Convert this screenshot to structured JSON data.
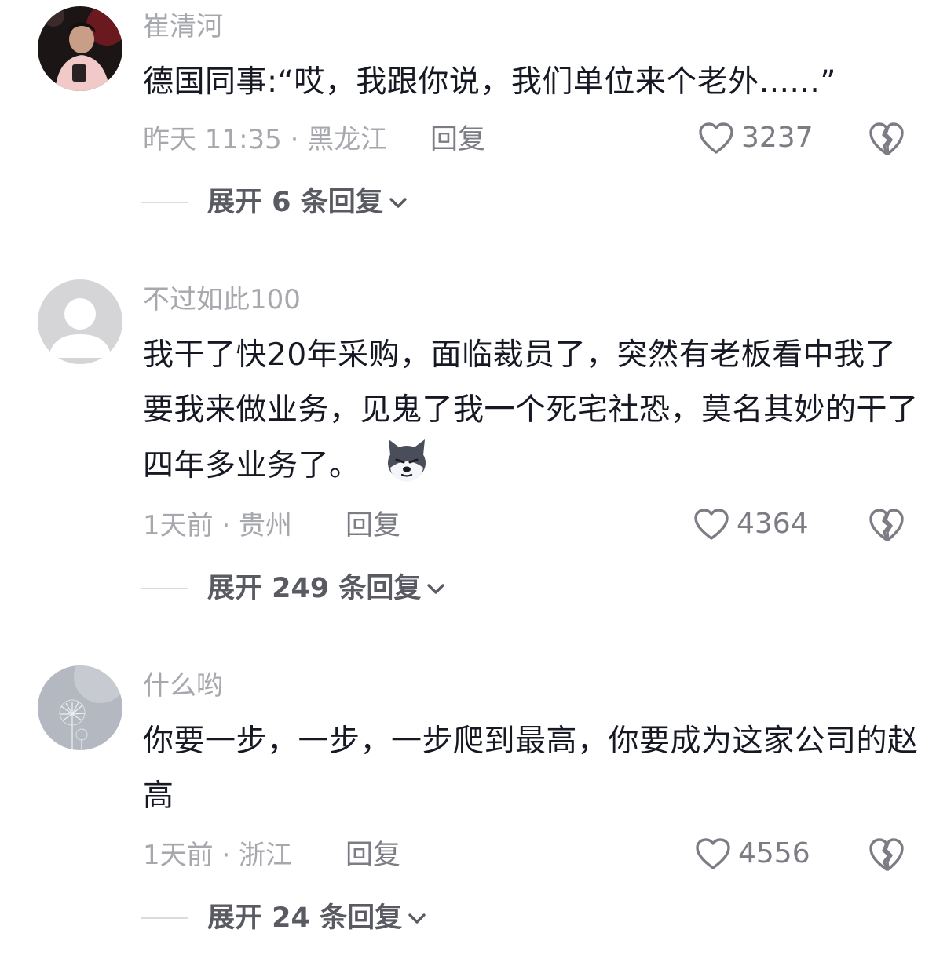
{
  "comments": [
    {
      "username": "崔清河",
      "avatar_icon": "user-photo-avatar",
      "text": "德国同事:“哎，我跟你说，我们单位来个老外......”",
      "time": "昨天 11:35",
      "location": "黑龙江",
      "time_location": "昨天 11:35 · 黑龙江",
      "reply_label": "回复",
      "like_icon": "heart-outline-icon",
      "likes": "3237",
      "dislike_icon": "broken-heart-icon",
      "expand_label": "展开 6 条回复"
    },
    {
      "username": "不过如此100",
      "avatar_icon": "default-user-avatar",
      "text": "我干了快20年采购，面临裁员了，突然有老板看中我了要我来做业务，见鬼了我一个死宅社恐，莫名其妙的干了四年多业务了。",
      "emoji": "husky-emoji",
      "time": "1天前",
      "location": "贵州",
      "time_location": "1天前 · 贵州",
      "reply_label": "回复",
      "like_icon": "heart-outline-icon",
      "likes": "4364",
      "dislike_icon": "broken-heart-icon",
      "expand_label": "展开 249 条回复"
    },
    {
      "username": "什么哟",
      "avatar_icon": "dandelion-photo-avatar",
      "text": "你要一步，一步，一步爬到最高，你要成为这家公司的赵高",
      "time": "1天前",
      "location": "浙江",
      "time_location": "1天前 · 浙江",
      "reply_label": "回复",
      "like_icon": "heart-outline-icon",
      "likes": "4556",
      "dislike_icon": "broken-heart-icon",
      "expand_label": "展开 24 条回复"
    }
  ]
}
